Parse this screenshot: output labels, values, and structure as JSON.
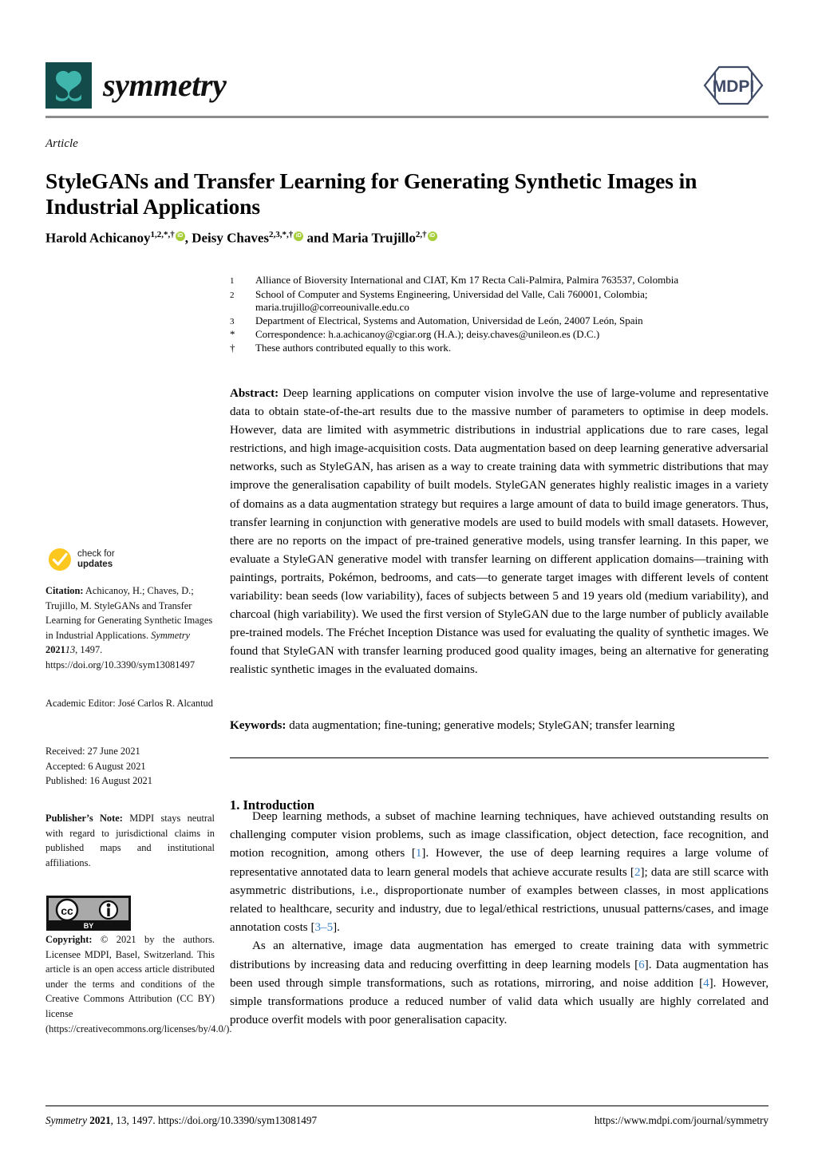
{
  "header": {
    "journal_name": "symmetry",
    "publisher_logo_text": "MDPI",
    "logo_colors": {
      "box": "#134b4b",
      "mark": "#3fb5ac",
      "mdpi": "#3f4a66"
    }
  },
  "title_block": {
    "kicker": "Article",
    "title": "StyleGANs and Transfer Learning for Generating Synthetic Images in Industrial Applications",
    "authors_plain": "Harold Achicanoy 1,2,*,† , Deisy Chaves 2,3,*,† and Maria Trujillo 2,†"
  },
  "authors": [
    {
      "name": "Harold Achicanoy",
      "sup": "1,2,*,†",
      "orcid": true,
      "sep": ", "
    },
    {
      "name": "Deisy Chaves",
      "sup": "2,3,*,†",
      "orcid": true,
      "sep": " and "
    },
    {
      "name": "Maria Trujillo",
      "sup": "2,†",
      "orcid": true,
      "sep": ""
    }
  ],
  "affiliations": [
    {
      "marker": "1",
      "text": "Alliance of Bioversity International and CIAT, Km 17 Recta Cali-Palmira, Palmira 763537, Colombia"
    },
    {
      "marker": "2",
      "text": "School of Computer and Systems Engineering, Universidad del Valle, Cali 760001, Colombia; maria.trujillo@correounivalle.edu.co"
    },
    {
      "marker": "3",
      "text": "Department of Electrical, Systems and Automation, Universidad de León, 24007 León, Spain"
    },
    {
      "marker": "*",
      "text": "Correspondence: h.a.achicanoy@cgiar.org (H.A.); deisy.chaves@unileon.es (D.C.)"
    },
    {
      "marker": "†",
      "text": "These authors contributed equally to this work."
    }
  ],
  "abstract": {
    "label": "Abstract:",
    "text": "Deep learning applications on computer vision involve the use of large-volume and representative data to obtain state-of-the-art results due to the massive number of parameters to optimise in deep models. However, data are limited with asymmetric distributions in industrial applications due to rare cases, legal restrictions, and high image-acquisition costs. Data augmentation based on deep learning generative adversarial networks, such as StyleGAN, has arisen as a way to create training data with symmetric distributions that may improve the generalisation capability of built models. StyleGAN generates highly realistic images in a variety of domains as a data augmentation strategy but requires a large amount of data to build image generators. Thus, transfer learning in conjunction with generative models are used to build models with small datasets. However, there are no reports on the impact of pre-trained generative models, using transfer learning. In this paper, we evaluate a StyleGAN generative model with transfer learning on different application domains—training with paintings, portraits, Pokémon, bedrooms, and cats—to generate target images with different levels of content variability: bean seeds (low variability), faces of subjects between 5 and 19 years old (medium variability), and charcoal (high variability). We used the first version of StyleGAN due to the large number of publicly available pre-trained models. The Fréchet Inception Distance was used for evaluating the quality of synthetic images. We found that StyleGAN with transfer learning produced good quality images, being an alternative for generating realistic synthetic images in the evaluated domains."
  },
  "keywords": {
    "label": "Keywords:",
    "text": "data augmentation; fine-tuning; generative models; StyleGAN; transfer learning"
  },
  "body": {
    "section_heading": "1. Introduction",
    "paragraph_1_a": "Deep learning methods, a subset of machine learning techniques, have achieved outstanding results on challenging computer vision problems, such as image classification, object detection, face recognition, and motion recognition, among others [",
    "ref_1": "1",
    "paragraph_1_b": "]. However, the use of deep learning requires a large volume of representative annotated data to learn general models that achieve accurate results [",
    "ref_2": "2",
    "paragraph_1_c": "]; data are still scarce with asymmetric distributions, i.e., disproportionate number of examples between classes, in most applications related to healthcare, security and industry, due to legal/ethical restrictions, unusual patterns/cases, and image annotation costs [",
    "ref_3": "3–5",
    "paragraph_1_d": "].",
    "paragraph_2_a": "As an alternative, image data augmentation has emerged to create training data with symmetric distributions by increasing data and reducing overfitting in deep learning models [",
    "ref_4": "6",
    "paragraph_2_b": "]. Data augmentation has been used through simple transformations, such as rotations, mirroring, and noise addition [",
    "ref_5": "4",
    "paragraph_2_c": "]. However, simple transformations produce a reduced number of valid data which usually are highly correlated and produce overfit models with poor generalisation capacity."
  },
  "sidebar": {
    "check_updates_line1": "check for",
    "check_updates_line2": "updates",
    "citation_label": "Citation:",
    "citation_text": " Achicanoy, H.; Chaves, D.; Trujillo, M. StyleGANs and Transfer Learning for Generating Synthetic Images in Industrial Applications. ",
    "citation_journal": "Symmetry",
    "citation_year": "2021",
    "citation_vol": "13",
    "citation_issue": ", 1497. ",
    "citation_doi": "https://doi.org/10.3390/sym13081497",
    "academic_editor": "Academic Editor: José Carlos R. Alcantud",
    "received": "Received: 27 June 2021",
    "accepted": "Accepted: 6 August 2021",
    "published": "Published: 16 August 2021",
    "publisher_note_label": "Publisher’s Note:",
    "publisher_note_text": " MDPI stays neutral with regard to jurisdictional claims in published maps and institutional affiliations.",
    "copyright_label": "Copyright:",
    "copyright_text": " © 2021 by the authors. Licensee MDPI, Basel, Switzerland. This article is an open access article distributed under the terms and conditions of the Creative Commons Attribution (CC BY) license (https://creativecommons.org/licenses/by/4.0/).",
    "cc_badge_cc": "cc",
    "cc_badge_by": "BY"
  },
  "footer": {
    "left_journal": "Symmetry",
    "left_rest_bold": "2021",
    "left_rest": ", 13, 1497. https://doi.org/10.3390/sym13081497",
    "right": "https://www.mdpi.com/journal/symmetry"
  }
}
